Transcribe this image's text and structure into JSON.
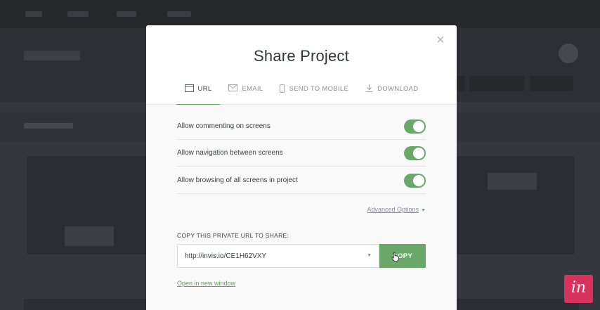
{
  "modal": {
    "title": "Share Project",
    "close_symbol": "×",
    "tabs": [
      {
        "label": "URL",
        "icon": "browser-window-icon",
        "active": true
      },
      {
        "label": "EMAIL",
        "icon": "envelope-icon",
        "active": false
      },
      {
        "label": "SEND TO MOBILE",
        "icon": "mobile-phone-icon",
        "active": false
      },
      {
        "label": "DOWNLOAD",
        "icon": "download-icon",
        "active": false
      }
    ],
    "options": [
      {
        "label": "Allow commenting on screens",
        "enabled": true
      },
      {
        "label": "Allow navigation between screens",
        "enabled": true
      },
      {
        "label": "Allow browsing of all screens in project",
        "enabled": true
      }
    ],
    "advanced_options": "Advanced Options",
    "url_section_label": "COPY THIS PRIVATE URL TO SHARE:",
    "url_value": "http://invis.io/CE1H62VXY",
    "copy_label": "COPY",
    "open_link": "Open in new window"
  },
  "logo": {
    "text": "in"
  },
  "colors": {
    "accent": "#6aa86a",
    "logo_bg": "#d9325f",
    "overlay_bg": "#34373d"
  }
}
